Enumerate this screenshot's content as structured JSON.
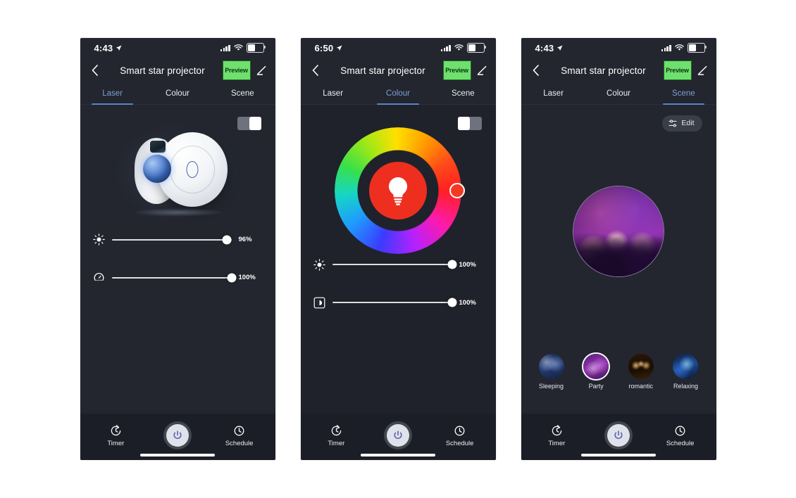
{
  "app": {
    "title": "Smart star projector",
    "preview_label": "Preview",
    "tabs": [
      "Laser",
      "Colour",
      "Scene"
    ],
    "accent": "#5b83c4",
    "preview_bg": "#6ee06e",
    "background": "#23262f"
  },
  "bottom_nav": {
    "timer_label": "Timer",
    "schedule_label": "Schedule",
    "power_icon": "power-icon",
    "timer_icon": "timer-icon",
    "schedule_icon": "clock-icon"
  },
  "phones": [
    {
      "status": {
        "time": "4:43",
        "location_icon": "location-arrow-icon",
        "signal_icon": "signal-bars-icon",
        "wifi_icon": "wifi-icon",
        "battery_icon": "battery-icon"
      },
      "active_tab": "Laser",
      "toggle": {
        "state": "on",
        "name": "power-toggle"
      },
      "hero": "star-projector-device",
      "sliders": [
        {
          "icon": "brightness-icon",
          "value": "96%",
          "percent": 96,
          "name": "brightness-slider"
        },
        {
          "icon": "rotation-speed-icon",
          "value": "100%",
          "percent": 100,
          "name": "speed-slider"
        }
      ]
    },
    {
      "status": {
        "time": "6:50",
        "location_icon": "location-arrow-icon",
        "signal_icon": "signal-bars-icon",
        "wifi_icon": "wifi-icon",
        "battery_icon": "battery-icon"
      },
      "active_tab": "Colour",
      "toggle": {
        "state": "off",
        "name": "power-toggle"
      },
      "hero": "colour-wheel",
      "wheel": {
        "selected_color": "#ee2f20",
        "center_icon": "bulb-icon",
        "handle_angle_deg": 0
      },
      "sliders": [
        {
          "icon": "brightness-icon",
          "value": "100%",
          "percent": 100,
          "name": "brightness-slider"
        },
        {
          "icon": "saturation-icon",
          "value": "100%",
          "percent": 100,
          "name": "saturation-slider"
        }
      ]
    },
    {
      "status": {
        "time": "4:43",
        "location_icon": "location-arrow-icon",
        "signal_icon": "signal-bars-icon",
        "wifi_icon": "wifi-icon",
        "battery_icon": "battery-icon"
      },
      "active_tab": "Scene",
      "edit_label": "Edit",
      "edit_icon": "sliders-icon",
      "hero": "scene-preview-party",
      "scenes": [
        {
          "label": "Sleeping",
          "selected": false,
          "thumb": "th-sleep"
        },
        {
          "label": "Party",
          "selected": true,
          "thumb": "th-party"
        },
        {
          "label": "romantic",
          "selected": false,
          "thumb": "th-romantic"
        },
        {
          "label": "Relaxing",
          "selected": false,
          "thumb": "th-relax"
        }
      ]
    }
  ]
}
